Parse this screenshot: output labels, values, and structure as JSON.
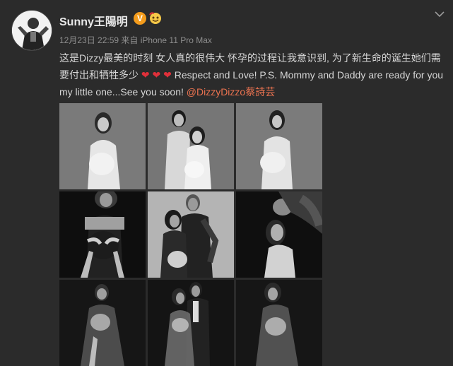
{
  "post": {
    "author": "Sunny王陽明",
    "vip_badge": "V",
    "meta": "12月23日 22:59 来自 iPhone 11 Pro Max",
    "text_part1": "这是Dizzy最美的时刻 女人真的很伟大 怀孕的过程让我意识到, 为了新生命的诞生她们需要付出和牺牲多少",
    "hearts": "❤ ❤ ❤",
    "text_part2": " Respect and Love! P.S. Mommy and Daddy are ready for you my little one...See you soon! ",
    "mention": "@DizzyDizzo蔡詩芸"
  },
  "icons": {
    "avatar": "avatar-photo",
    "vip": "vip-badge-icon",
    "emoji": "emoji-badge-icon",
    "menu": "chevron-down-icon"
  },
  "colors": {
    "background": "#2b2b2b",
    "text": "#d6d6d6",
    "meta": "#8e8e8e",
    "mention": "#eb7350",
    "heart": "#e0303a",
    "vip": "#f49c1c"
  },
  "photos": [
    {
      "name": "photo-1",
      "tone": "light",
      "figure": "woman-white-dress"
    },
    {
      "name": "photo-2",
      "tone": "light",
      "figure": "couple-white"
    },
    {
      "name": "photo-3",
      "tone": "light",
      "figure": "woman-white-dress"
    },
    {
      "name": "photo-4",
      "tone": "dark",
      "figure": "woman-black-hands"
    },
    {
      "name": "photo-5",
      "tone": "light",
      "figure": "couple-tattoo"
    },
    {
      "name": "photo-6",
      "tone": "dark",
      "figure": "couple-kiss"
    },
    {
      "name": "photo-7",
      "tone": "dark",
      "figure": "woman-sheer-gown"
    },
    {
      "name": "photo-8",
      "tone": "dark",
      "figure": "couple-suit"
    },
    {
      "name": "photo-9",
      "tone": "dark",
      "figure": "woman-sheer-gown"
    }
  ]
}
